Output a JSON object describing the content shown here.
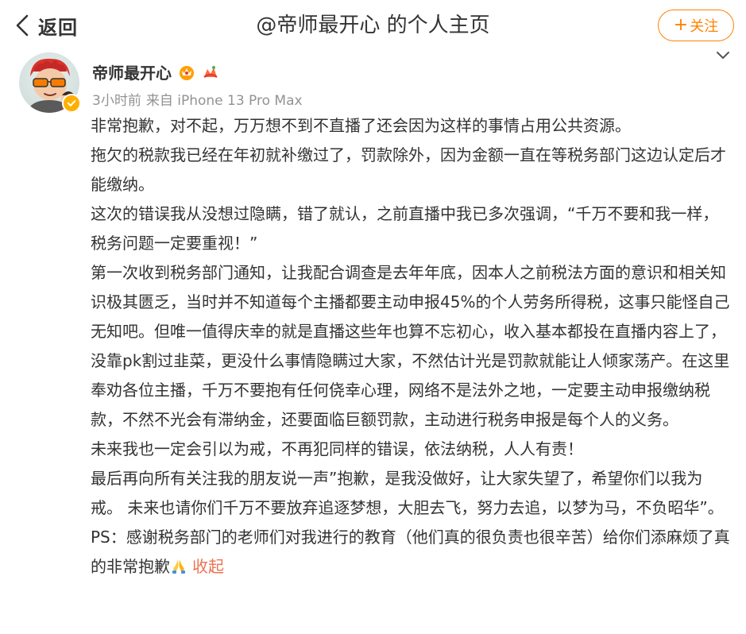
{
  "header": {
    "back_label": "返回",
    "title": "@帝师最开心 的个人主页",
    "follow_label": "关注",
    "follow_plus": "+",
    "accent_color": "#ff8200"
  },
  "post": {
    "username": "帝师最开心",
    "time": "3小时前",
    "source": "来自 iPhone 13 Pro Max",
    "paragraphs": [
      "非常抱歉，对不起，万万想不到不直播了还会因为这样的事情占用公共资源。",
      "拖欠的税款我已经在年初就补缴过了，罚款除外，因为金额一直在等税务部门这边认定后才能缴纳。",
      "这次的错误我从没想过隐瞒，错了就认，之前直播中我已多次强调，“千万不要和我一样，税务问题一定要重视！”",
      "第一次收到税务部门通知，让我配合调查是去年年底，因本人之前税法方面的意识和相关知识极其匮乏，当时并不知道每个主播都要主动申报45%的个人劳务所得税，这事只能怪自己无知吧。但唯一值得庆幸的就是直播这些年也算不忘初心，收入基本都投在直播内容上了，没靠pk割过韭菜，更没什么事情隐瞒过大家，不然估计光是罚款就能让人倾家荡产。在这里奉劝各位主播，千万不要抱有任何侥幸心理，网络不是法外之地，一定要主动申报缴纳税款，不然不光会有滞纳金，还要面临巨额罚款，主动进行税务申报是每个人的义务。",
      "未来我也一定会引以为戒，不再犯同样的错误，依法纳税，人人有责！",
      "最后再向所有关注我的朋友说一声”抱歉，是我没做好，让大家失望了，希望你们以我为戒。  未来也请你们千万不要放弃追逐梦想，大胆去飞，努力去追，以梦为马，不负昭华”。",
      "PS：感谢税务部门的老师们对我进行的教育（他们真的很负责也很辛苦）给你们添麻烦了真的非常抱歉"
    ],
    "collapse_label": "收起",
    "icons": [
      "crown-badge-icon",
      "vip-badge-icon",
      "verified-icon",
      "praying-hands-icon",
      "chevron-down-icon"
    ]
  }
}
